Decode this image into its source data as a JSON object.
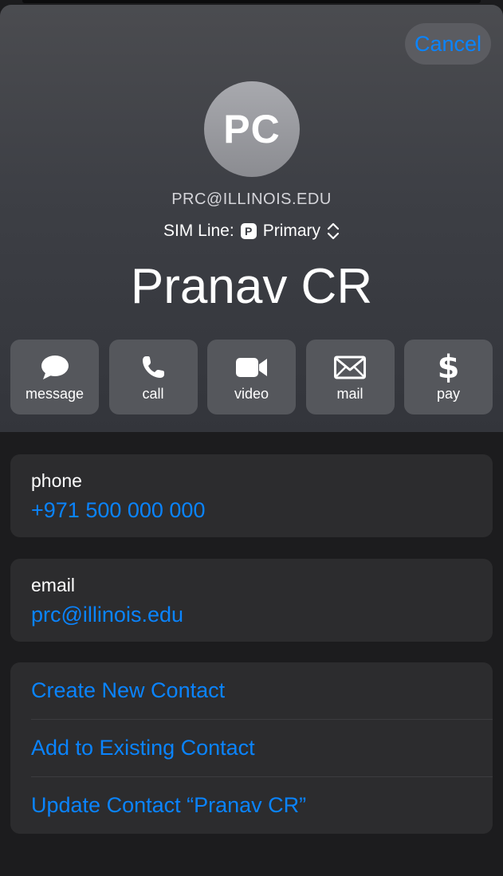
{
  "header": {
    "cancel_label": "Cancel",
    "avatar_initials": "PC",
    "email_caption": "PRC@ILLINOIS.EDU",
    "sim_line_label": "SIM Line:",
    "sim_badge": "P",
    "sim_value": "Primary",
    "contact_name": "Pranav CR"
  },
  "actions": [
    {
      "label": "message",
      "icon": "message-bubble-icon"
    },
    {
      "label": "call",
      "icon": "phone-icon"
    },
    {
      "label": "video",
      "icon": "video-camera-icon"
    },
    {
      "label": "mail",
      "icon": "envelope-icon"
    },
    {
      "label": "pay",
      "icon": "dollar-icon"
    }
  ],
  "phone": {
    "label": "phone",
    "value": "+971 500 000 000"
  },
  "email": {
    "label": "email",
    "value": "prc@illinois.edu"
  },
  "contact_actions": [
    "Create New Contact",
    "Add to Existing Contact",
    "Update Contact “Pranav CR”"
  ],
  "colors": {
    "accent": "#0a84ff",
    "background": "#1c1c1e",
    "card": "#2c2c2e"
  }
}
